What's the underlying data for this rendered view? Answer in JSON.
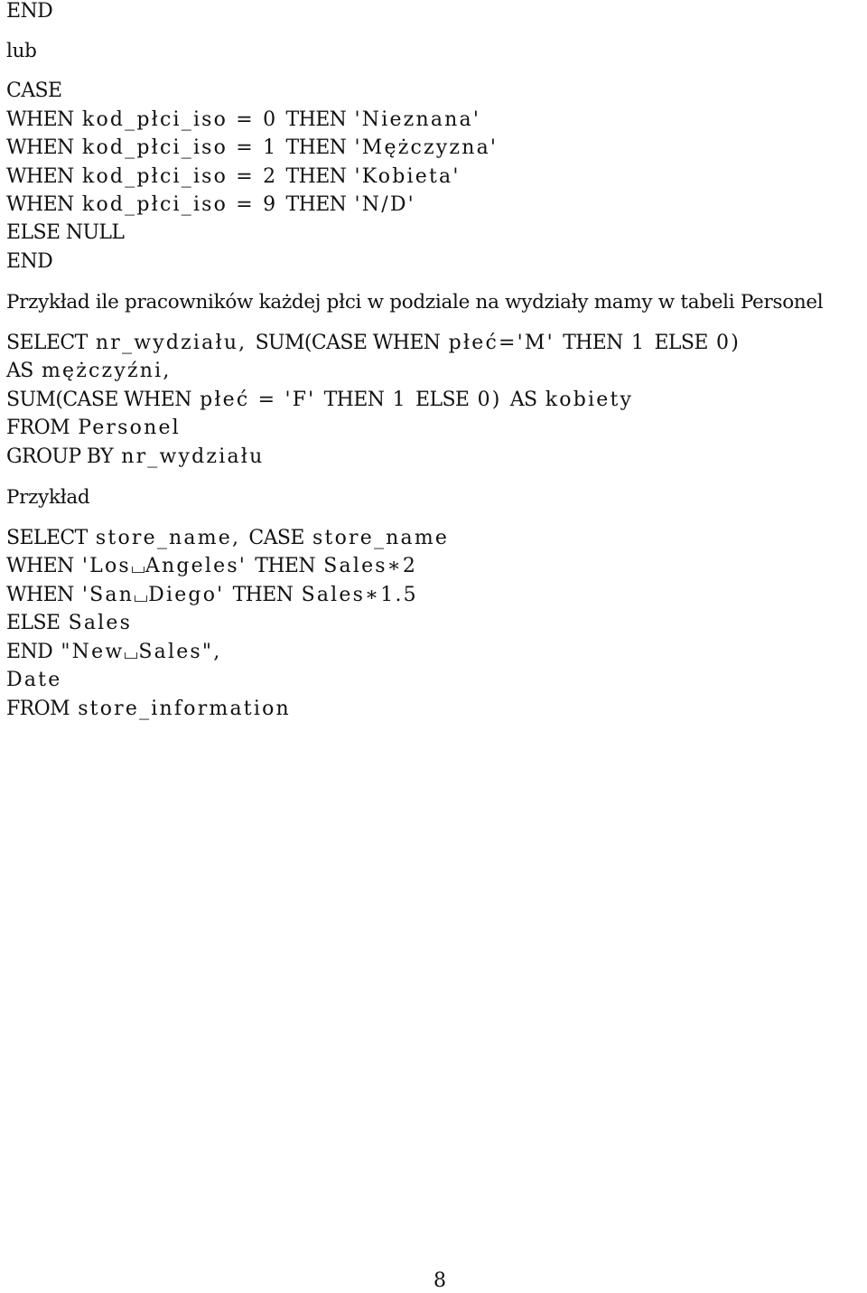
{
  "document": {
    "section1": {
      "end_prev": "END",
      "or": "lub",
      "case_block": [
        {
          "kw": "CASE",
          "rest": ""
        },
        {
          "kw": "WHEN",
          "rest": " kod_płci_iso = 0 ",
          "kw2": "THEN",
          "rest2": " 'Nieznana'"
        },
        {
          "kw": "WHEN",
          "rest": " kod_płci_iso = 1 ",
          "kw2": "THEN",
          "rest2": " 'Mężczyzna'"
        },
        {
          "kw": "WHEN",
          "rest": " kod_płci_iso = 2 ",
          "kw2": "THEN",
          "rest2": " 'Kobieta'"
        },
        {
          "kw": "WHEN",
          "rest": " kod_płci_iso = 9 ",
          "kw2": "THEN",
          "rest2": " 'N/D'"
        },
        {
          "kw": "ELSE NULL",
          "rest": ""
        },
        {
          "kw": "END",
          "rest": ""
        }
      ]
    },
    "example1": {
      "heading": "Przykład ile pracowników każdej płci w podziale na wydziały mamy w tabeli Personel",
      "lines": [
        {
          "a": "SELECT",
          "b": " nr_wydziału, ",
          "c": "SUM(CASE WHEN",
          "d": " płeć='M' ",
          "e": "THEN",
          "f": " 1 ",
          "g": "ELSE",
          "h": " 0)"
        },
        {
          "a": "AS",
          "b": " mężczyźni,"
        },
        {
          "a": "SUM(CASE WHEN",
          "b": " płeć = 'F' ",
          "c": "THEN",
          "d": " 1 ",
          "e": "ELSE",
          "f": " 0) ",
          "g": "AS",
          "h": " kobiety"
        },
        {
          "a": "FROM",
          "b": " Personel"
        },
        {
          "a": "GROUP BY",
          "b": " nr_wydziału"
        }
      ]
    },
    "example2": {
      "heading": "Przykład",
      "line1": {
        "a": "SELECT",
        "b": " store_name, ",
        "c": "CASE",
        "d": " store_name"
      },
      "line2": {
        "a": "WHEN",
        "b": " 'Los",
        "b2": "Angeles' ",
        "c": "THEN",
        "d": " Sales∗2"
      },
      "line3": {
        "a": "WHEN",
        "b": " 'San",
        "b2": "Diego' ",
        "c": "THEN",
        "d": " Sales∗1.5"
      },
      "line4": {
        "a": "ELSE",
        "b": " Sales"
      },
      "line5": {
        "a": "END",
        "b": " \"New",
        "b2": "Sales\","
      },
      "line6": {
        "a": "Date"
      },
      "line7": {
        "a": "FROM",
        "b": " store_information"
      }
    },
    "page_number": "8"
  }
}
